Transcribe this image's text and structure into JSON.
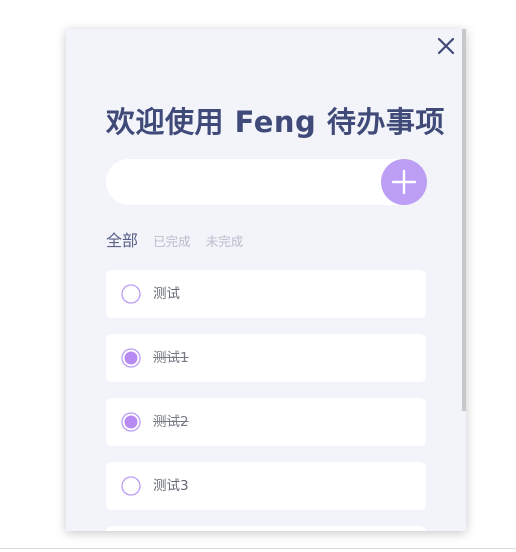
{
  "app": {
    "title": "欢迎使用 Feng 待办事项"
  },
  "input": {
    "value": "",
    "placeholder": ""
  },
  "filters": [
    {
      "label": "全部",
      "active": true
    },
    {
      "label": "已完成",
      "active": false
    },
    {
      "label": "未完成",
      "active": false
    }
  ],
  "todos": [
    {
      "text": "测试",
      "done": false
    },
    {
      "text": "测试1",
      "done": true
    },
    {
      "text": "测试2",
      "done": true
    },
    {
      "text": "测试3",
      "done": false
    }
  ],
  "colors": {
    "accent": "#bc9ef5",
    "title": "#404a78",
    "panel_bg": "#f3f4f9"
  },
  "icons": {
    "close": "close-icon",
    "add": "plus-icon",
    "unchecked": "radio-unchecked-icon",
    "checked": "radio-checked-icon"
  }
}
